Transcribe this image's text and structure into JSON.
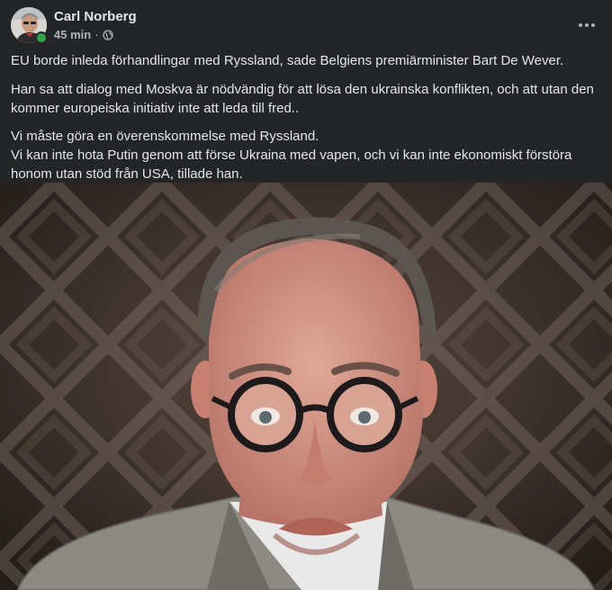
{
  "post": {
    "author_name": "Carl Norberg",
    "time_label": "45 min",
    "separator": "·",
    "privacy_icon": "globe-icon",
    "more_icon": "more-dots-icon",
    "paragraphs": [
      "EU borde inleda förhandlingar med Ryssland, sade Belgiens premiärminister Bart De Wever.",
      "Han sa att dialog med Moskva är nödvändig för att lösa den ukrainska konflikten, och att utan den kommer europeiska initiativ inte att leda till fred..",
      "Vi måste göra en överenskommelse med Ryssland.",
      "Vi kan inte hota Putin genom att förse Ukraina med vapen, och vi kan inte ekonomiskt förstöra honom utan stöd från USA, tillade han."
    ]
  },
  "colors": {
    "background": "#242526",
    "primary_text": "#e4e6eb",
    "secondary_text": "#b0b3b8",
    "online_status": "#31a24c"
  }
}
